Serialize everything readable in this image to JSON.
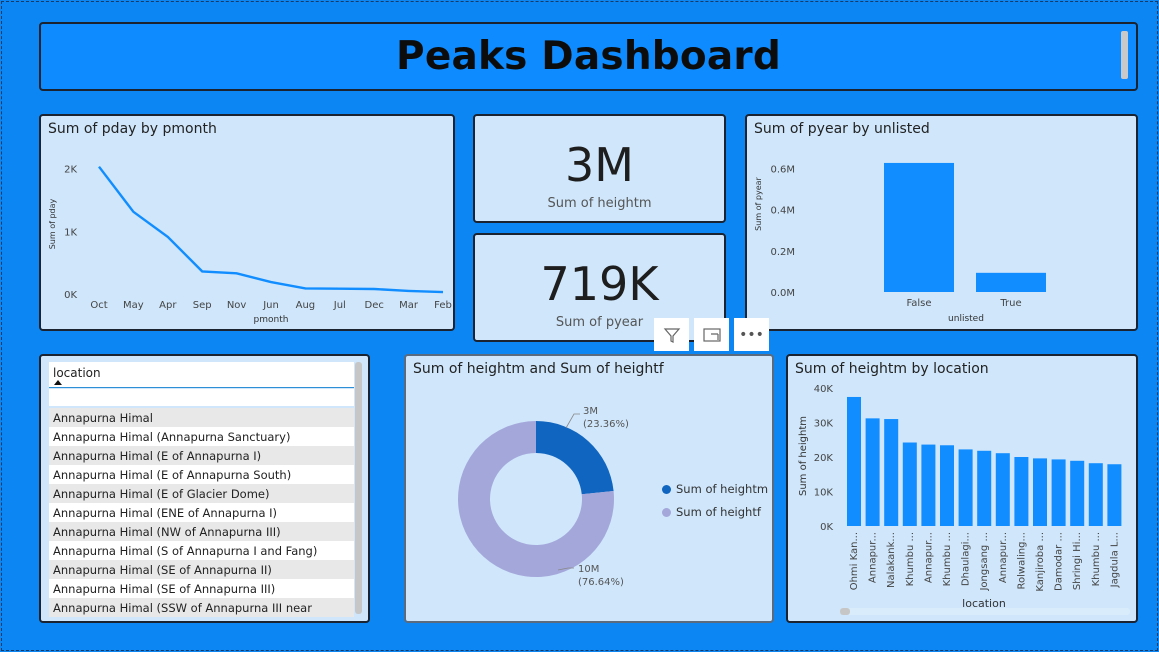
{
  "header": {
    "title": "Peaks Dashboard"
  },
  "line_chart": {
    "title": "Sum of pday by pmonth",
    "chart_data": {
      "type": "line",
      "title": "Sum of pday by pmonth",
      "xlabel": "pmonth",
      "ylabel": "Sum of pday",
      "categories": [
        "Oct",
        "May",
        "Apr",
        "Sep",
        "Nov",
        "Jun",
        "Aug",
        "Jul",
        "Dec",
        "Mar",
        "Feb"
      ],
      "values": [
        2030,
        1310,
        910,
        360,
        330,
        190,
        90,
        85,
        80,
        50,
        30
      ],
      "yticks": [
        "0K",
        "1K",
        "2K"
      ],
      "ylim": [
        0,
        2200
      ],
      "color": "#118dff"
    }
  },
  "card_heightm": {
    "value": "3M",
    "label": "Sum of heightm"
  },
  "card_pyear": {
    "value": "719K",
    "label": "Sum of pyear"
  },
  "bar_chart_unlisted": {
    "title": "Sum of pyear by unlisted",
    "chart_data": {
      "type": "bar",
      "title": "Sum of pyear by unlisted",
      "xlabel": "unlisted",
      "ylabel": "Sum of pyear",
      "categories": [
        "False",
        "True"
      ],
      "values": [
        626000,
        93000
      ],
      "yticks": [
        "0.0M",
        "0.2M",
        "0.4M",
        "0.6M"
      ],
      "ylim": [
        0,
        0.65
      ],
      "color": "#118dff"
    }
  },
  "toolbar": {
    "filter_icon": "filter-icon",
    "focus_icon": "focus-mode-icon",
    "more_label": "•••"
  },
  "slicer": {
    "header": "location",
    "items": [
      "Annapurna Himal",
      "Annapurna Himal (Annapurna Sanctuary)",
      "Annapurna Himal (E of Annapurna I)",
      "Annapurna Himal (E of Annapurna South)",
      "Annapurna Himal (E of Glacier Dome)",
      "Annapurna Himal (ENE of Annapurna I)",
      "Annapurna Himal (NW of Annapurna III)",
      "Annapurna Himal (S of Annapurna I and Fang)",
      "Annapurna Himal (SE of Annapurna II)",
      "Annapurna Himal (SE of Annapurna III)",
      "Annapurna Himal (SSW of Annapurna III near"
    ]
  },
  "donut": {
    "title": "Sum of heightm and Sum of heightf",
    "chart_data": {
      "type": "pie",
      "title": "Sum of heightm and Sum of heightf",
      "series": [
        {
          "name": "Sum of heightm",
          "value_label": "3M",
          "percent_label": "(23.36%)",
          "percent": 23.36,
          "color": "#1065c0"
        },
        {
          "name": "Sum of heightf",
          "value_label": "10M",
          "percent_label": "(76.64%)",
          "percent": 76.64,
          "color": "#a4a7da"
        }
      ]
    }
  },
  "location_chart": {
    "title": "Sum of heightm by location",
    "chart_data": {
      "type": "bar",
      "title": "Sum of heightm by location",
      "xlabel": "location",
      "ylabel": "Sum of heightm",
      "categories": [
        "Ohmi Kan...",
        "Annapur...",
        "Nalakank...",
        "Khumbu ...",
        "Annapur...",
        "Khumbu ...",
        "Dhaulagi...",
        "Jongsang ...",
        "Annapur...",
        "Rolwaling...",
        "Kanjiroba ...",
        "Damodar ...",
        "Shringi Hi...",
        "Khumbu ...",
        "Jagdula L..."
      ],
      "values": [
        37400,
        31200,
        31000,
        24200,
        23600,
        23400,
        22200,
        21800,
        21100,
        20000,
        19600,
        19300,
        18900,
        18200,
        17900
      ],
      "yticks": [
        "0K",
        "10K",
        "20K",
        "30K",
        "40K"
      ],
      "ylim": [
        0,
        40000
      ],
      "color": "#118dff"
    }
  }
}
